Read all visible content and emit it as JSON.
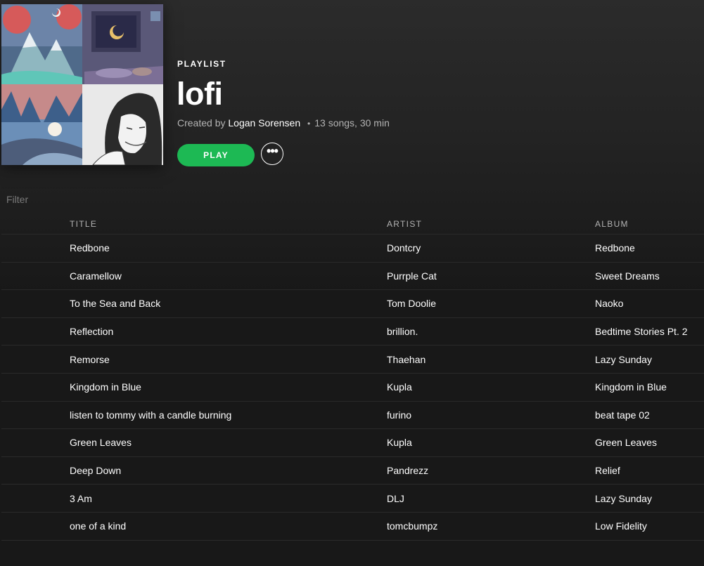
{
  "playlist": {
    "type_label": "PLAYLIST",
    "name": "lofi",
    "created_by_prefix": "Created by",
    "owner": "Logan Sorensen",
    "separator": "•",
    "stats": "13 songs, 30 min"
  },
  "actions": {
    "play_label": "PLAY",
    "more_label": "•••"
  },
  "filter": {
    "placeholder": "Filter"
  },
  "columns": {
    "title": "TITLE",
    "artist": "ARTIST",
    "album": "ALBUM"
  },
  "tracks": [
    {
      "title": "Redbone",
      "artist": "Dontcry",
      "album": "Redbone"
    },
    {
      "title": "Caramellow",
      "artist": "Purrple Cat",
      "album": "Sweet Dreams"
    },
    {
      "title": "To the Sea and Back",
      "artist": "Tom Doolie",
      "album": "Naoko"
    },
    {
      "title": "Reflection",
      "artist": "brillion.",
      "album": "Bedtime Stories Pt. 2"
    },
    {
      "title": "Remorse",
      "artist": "Thaehan",
      "album": "Lazy Sunday"
    },
    {
      "title": "Kingdom in Blue",
      "artist": "Kupla",
      "album": "Kingdom in Blue"
    },
    {
      "title": "listen to tommy with a candle burning",
      "artist": "furino",
      "album": "beat tape 02"
    },
    {
      "title": "Green Leaves",
      "artist": "Kupla",
      "album": "Green Leaves"
    },
    {
      "title": "Deep Down",
      "artist": "Pandrezz",
      "album": "Relief"
    },
    {
      "title": "3 Am",
      "artist": "DLJ",
      "album": "Lazy Sunday"
    },
    {
      "title": "one of a kind",
      "artist": "tomcbumpz",
      "album": "Low Fidelity"
    }
  ],
  "colors": {
    "accent": "#1db954",
    "background": "#181818",
    "muted_text": "#b3b3b3"
  }
}
